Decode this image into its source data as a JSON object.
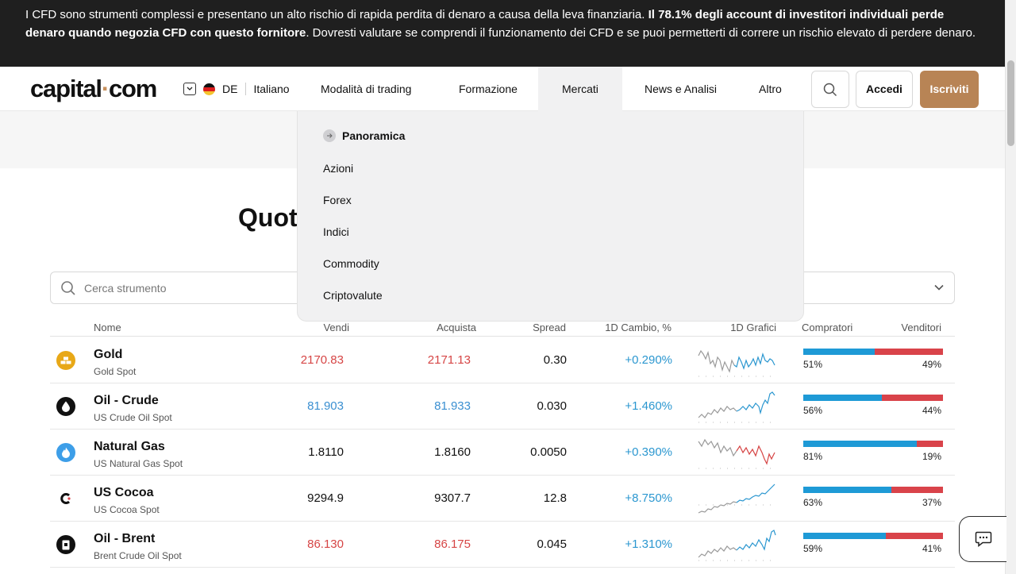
{
  "risk_banner": {
    "part1": "I CFD sono strumenti complessi e presentano un alto rischio di rapida perdita di denaro a causa della leva finanziaria.",
    "bold": "Il 78.1% degli account di investitori individuali perde denaro quando negozia CFD con questo fornitore",
    "part2": ". Dovresti valutare se comprendi il funzionamento dei CFD e se puoi permetterti di correre un rischio elevato di perdere denaro."
  },
  "header": {
    "logo_left": "capital",
    "logo_dot": "·",
    "logo_right": "com",
    "country_code": "DE",
    "language": "Italiano",
    "menu": [
      "Modalità di trading",
      "Formazione",
      "Mercati",
      "News e Analisi",
      "Altro"
    ],
    "login_label": "Accedi",
    "signup_label": "Iscriviti"
  },
  "markets_menu": {
    "overview": "Panoramica",
    "items": [
      "Azioni",
      "Forex",
      "Indici",
      "Commodity",
      "Criptovalute"
    ]
  },
  "page_title": "Quot",
  "search": {
    "placeholder": "Cerca strumento"
  },
  "table": {
    "headers": {
      "name": "Nome",
      "sell": "Vendi",
      "buy": "Acquista",
      "spread": "Spread",
      "change": "1D Cambio, %",
      "chart": "1D Grafici",
      "buyers": "Compratori",
      "sellers": "Venditori"
    },
    "rows": [
      {
        "name": "Gold",
        "sub": "Gold Spot",
        "sell": "2170.83",
        "buy": "2171.13",
        "spread": "0.30",
        "change": "+0.290%",
        "buyers_pct": "51%",
        "sellers_pct": "49%",
        "buyers_value": 51,
        "price_color": "red",
        "icon": "gold-bars-icon"
      },
      {
        "name": "Oil - Crude",
        "sub": "US Crude Oil Spot",
        "sell": "81.903",
        "buy": "81.933",
        "spread": "0.030",
        "change": "+1.460%",
        "buyers_pct": "56%",
        "sellers_pct": "44%",
        "buyers_value": 56,
        "price_color": "blue",
        "icon": "oil-drop-icon"
      },
      {
        "name": "Natural Gas",
        "sub": "US Natural Gas Spot",
        "sell": "1.8110",
        "buy": "1.8160",
        "spread": "0.0050",
        "change": "+0.390%",
        "buyers_pct": "81%",
        "sellers_pct": "19%",
        "buyers_value": 81,
        "price_color": "black",
        "icon": "gas-flame-icon"
      },
      {
        "name": "US Cocoa",
        "sub": "US Cocoa Spot",
        "sell": "9294.9",
        "buy": "9307.7",
        "spread": "12.8",
        "change": "+8.750%",
        "buyers_pct": "63%",
        "sellers_pct": "37%",
        "buyers_value": 63,
        "price_color": "black",
        "icon": "cocoa-icon"
      },
      {
        "name": "Oil - Brent",
        "sub": "Brent Crude Oil Spot",
        "sell": "86.130",
        "buy": "86.175",
        "spread": "0.045",
        "change": "+1.310%",
        "buyers_pct": "59%",
        "sellers_pct": "41%",
        "buyers_value": 59,
        "price_color": "red",
        "icon": "oil-barrel-icon"
      }
    ]
  },
  "colors": {
    "accent": "#b88455",
    "banner_bg": "#1f1f1f",
    "positive": "#2b97d0",
    "negative": "#d64545",
    "buyers_bar": "#1e9ad6",
    "sellers_bar": "#d9434a"
  }
}
